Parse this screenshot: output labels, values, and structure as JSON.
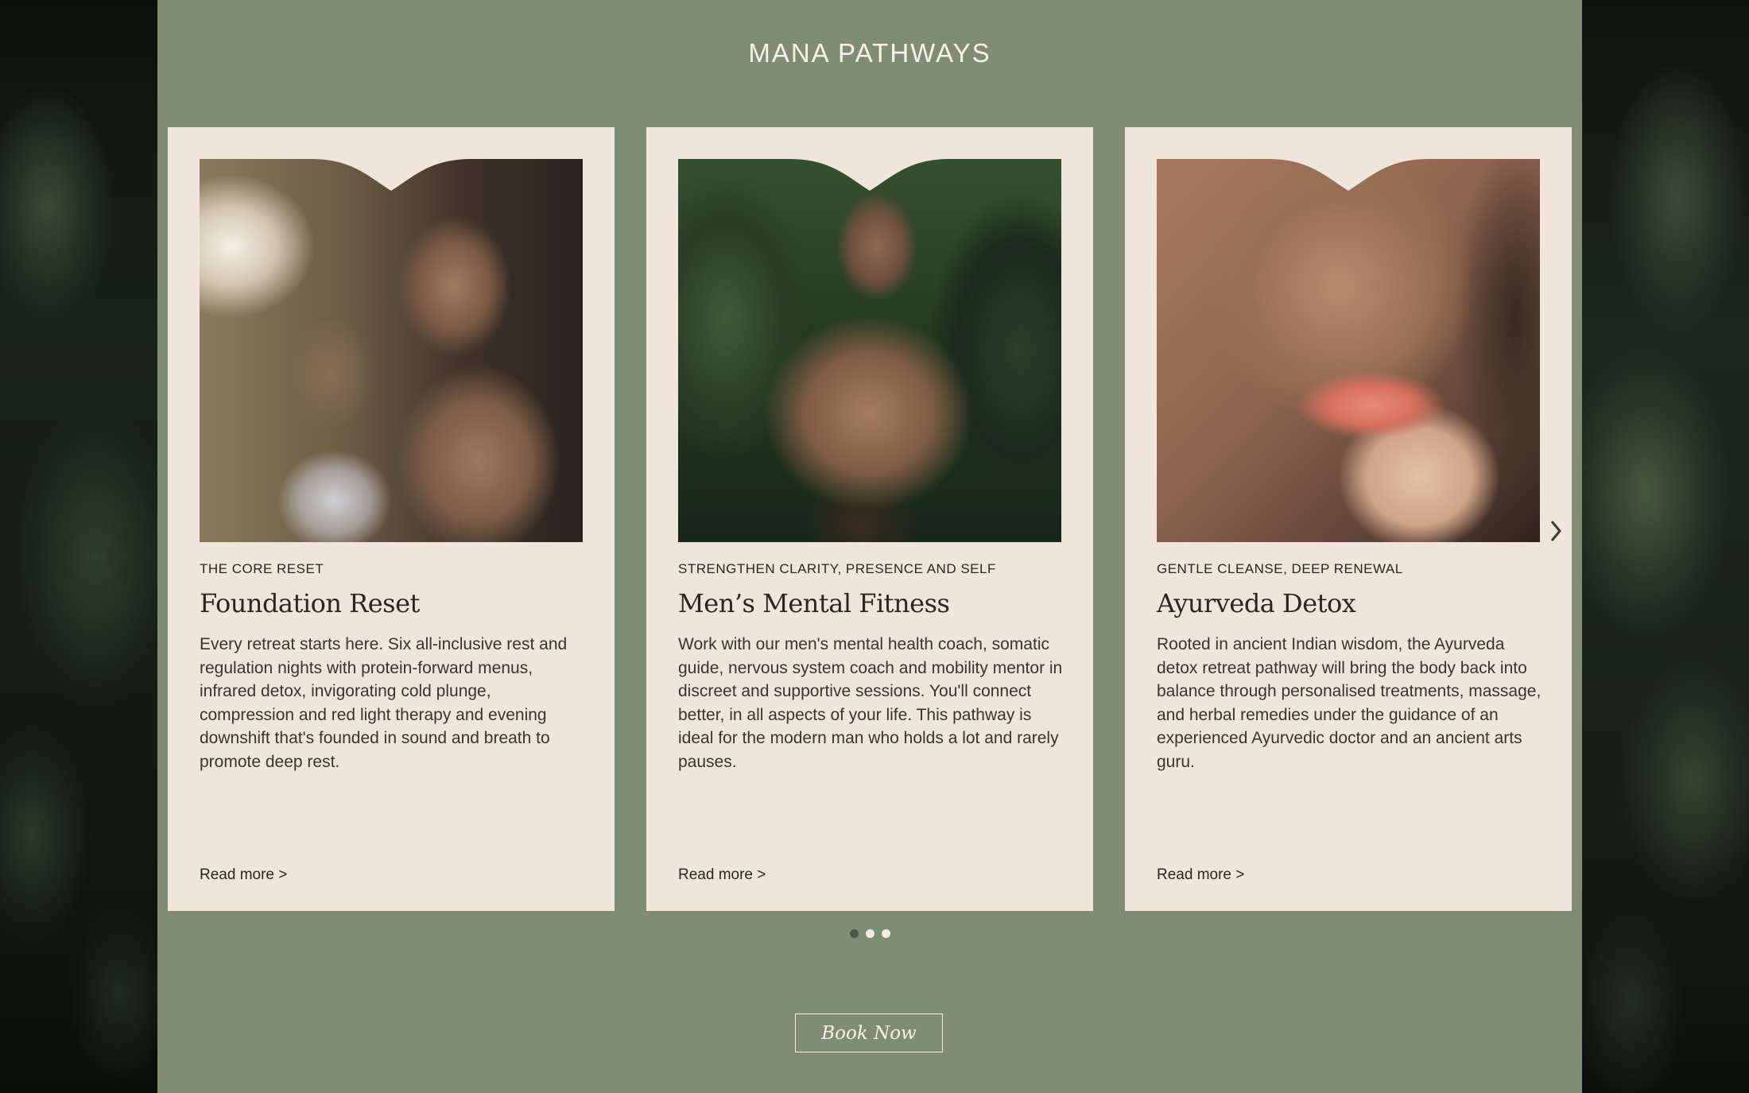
{
  "header": {
    "title": "MANA PATHWAYS"
  },
  "cards": [
    {
      "eyebrow": "THE CORE RESET",
      "title": "Foundation Reset",
      "text": "Every retreat starts here. Six all-inclusive rest and regulation nights with protein-forward menus, infrared detox, invigorating cold plunge, compression and red light therapy and evening downshift that's founded in sound and breath to promote deep rest.",
      "link": "Read more >"
    },
    {
      "eyebrow": "STRENGTHEN CLARITY, PRESENCE AND SELF",
      "title": "Men’s Mental Fitness",
      "text": "Work with our men's mental health coach, somatic guide, nervous system coach and mobility mentor in discreet and supportive sessions. You'll connect better, in all aspects of your life. This pathway is ideal for the modern man who holds a lot and rarely pauses.",
      "link": "Read more >"
    },
    {
      "eyebrow": "GENTLE CLEANSE, DEEP RENEWAL",
      "title": "Ayurveda Detox",
      "text": "Rooted in ancient Indian wisdom, the Ayurveda detox retreat pathway will bring the body back into balance through personalised treatments, massage, and herbal remedies under the guidance of an experienced Ayurvedic doctor and an ancient arts guru.",
      "link": "Read more >"
    }
  ],
  "carousel": {
    "prev_icon": "chevron-left-icon",
    "next_icon": "chevron-right-icon",
    "active_page": 1,
    "page_count": 3
  },
  "cta": {
    "label": "Book Now"
  },
  "colors": {
    "panel": "#7f8d74",
    "card": "#efe5db",
    "text": "#2b2620"
  }
}
